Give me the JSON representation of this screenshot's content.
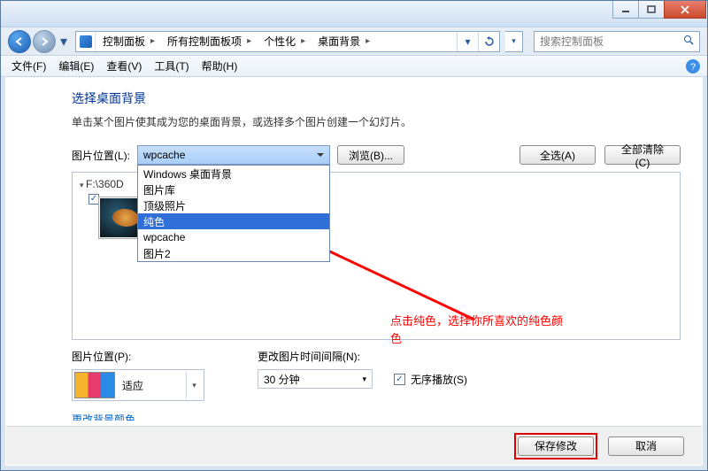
{
  "titlebar": {},
  "breadcrumb": {
    "seg1": "控制面板",
    "seg2": "所有控制面板项",
    "seg3": "个性化",
    "seg4": "桌面背景"
  },
  "search": {
    "placeholder": "搜索控制面板"
  },
  "menu": {
    "file": "文件(F)",
    "edit": "编辑(E)",
    "view": "查看(V)",
    "tools": "工具(T)",
    "help": "帮助(H)"
  },
  "page": {
    "title": "选择桌面背景",
    "desc": "单击某个图片使其成为您的桌面背景，或选择多个图片创建一个幻灯片。",
    "piclocation_label": "图片位置(L):",
    "browse_btn": "浏览(B)...",
    "selectall_btn": "全选(A)",
    "clearall_btn": "全部清除(C)",
    "tree_label": "F:\\360D",
    "picposition_label": "图片位置(P):",
    "interval_label": "更改图片时间间隔(N):",
    "shuffle_label": "无序播放(S)",
    "fit_value": "适应",
    "interval_value": "30 分钟",
    "change_color_link": "更改背景颜色",
    "save_btn": "保存修改",
    "cancel_btn": "取消"
  },
  "dropdown": {
    "current": "wpcache",
    "options": [
      "Windows 桌面背景",
      "图片库",
      "顶级照片",
      "纯色",
      "wpcache",
      "图片2"
    ],
    "selected_index": 3
  },
  "annotation": {
    "text1": "点击纯色，选择你所喜欢的纯色颜",
    "text2": "色"
  }
}
